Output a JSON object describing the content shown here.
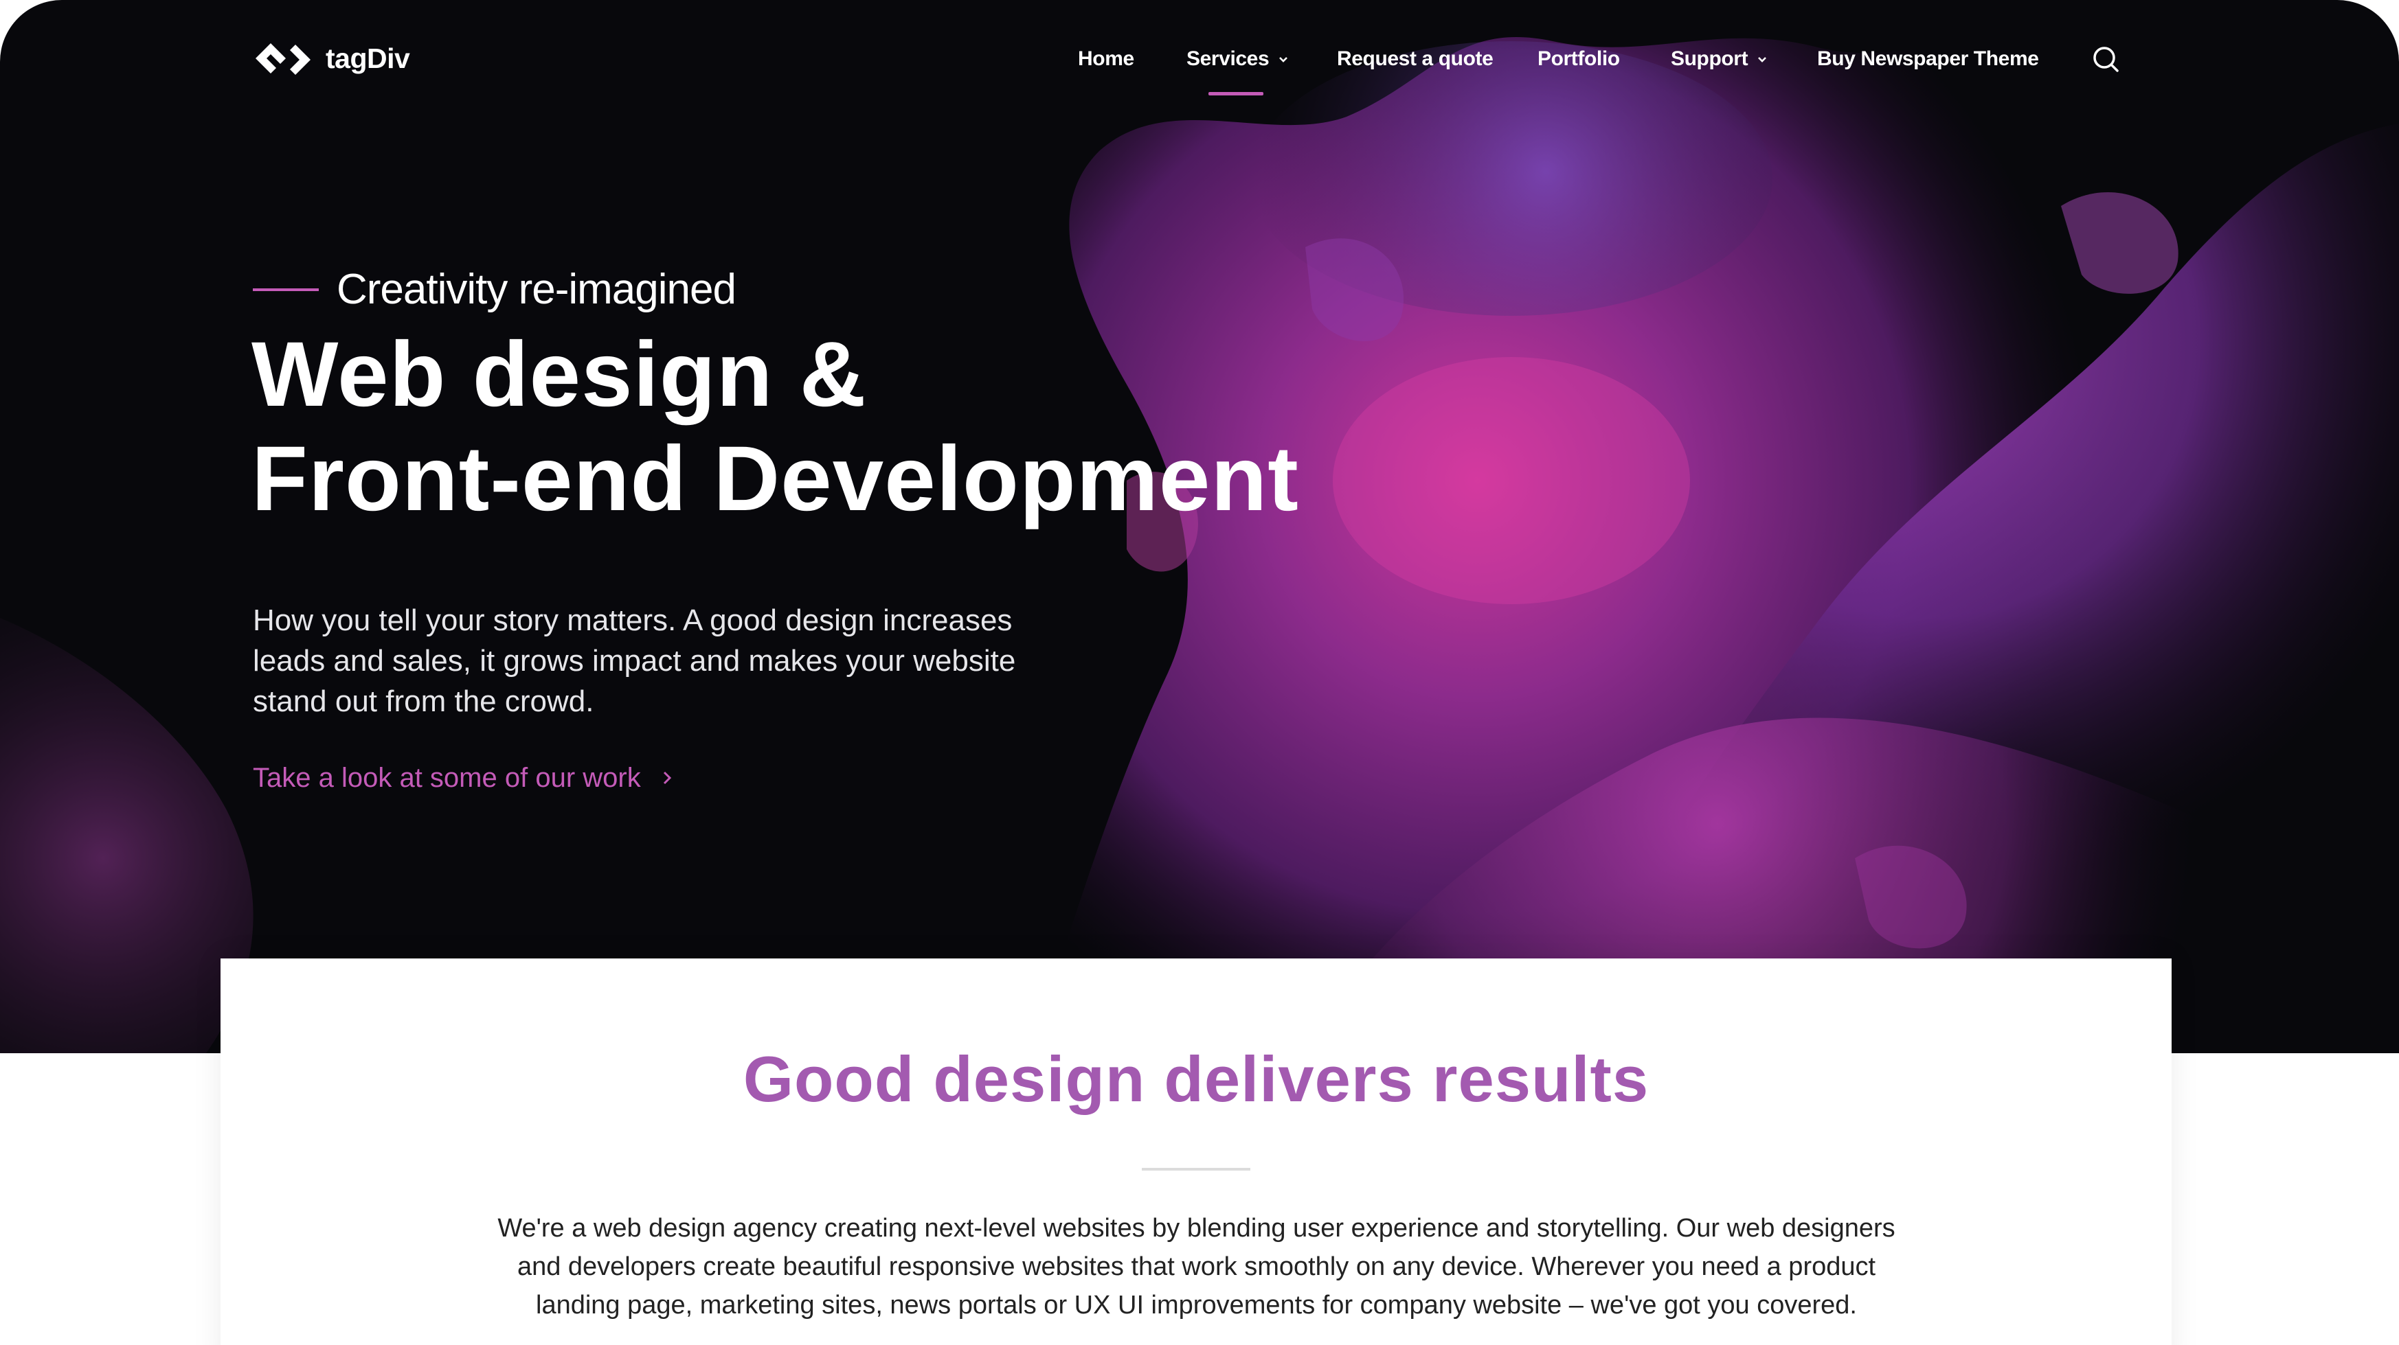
{
  "brand": {
    "name": "tagDiv",
    "accent": "#c45bb8",
    "title_color": "#a35ab0",
    "hero_background": "#08080c"
  },
  "nav": {
    "items": [
      {
        "label": "Home",
        "has_dropdown": false
      },
      {
        "label": "Services",
        "has_dropdown": true,
        "active": true
      },
      {
        "label": "Request a quote",
        "has_dropdown": false
      },
      {
        "label": "Portfolio",
        "has_dropdown": false
      },
      {
        "label": "Support",
        "has_dropdown": true
      },
      {
        "label": "Buy Newspaper Theme",
        "has_dropdown": false
      }
    ],
    "search_icon": "search-icon"
  },
  "hero": {
    "eyebrow": "Creativity re-imagined",
    "title_line1": "Web design &",
    "title_line2": "Front-end Development",
    "description": "How you tell your story matters. A good design increases leads and sales, it grows impact and makes your website stand out from the crowd.",
    "link_label": "Take a look at some of our work"
  },
  "section": {
    "title": "Good design delivers results",
    "body": "We're a web design agency creating next-level websites by blending user experience and storytelling. Our web designers and developers create beautiful responsive websites that work smoothly on any device. Wherever you need a product landing page, marketing sites, news portals or UX UI improvements for company website – we've got you covered."
  }
}
